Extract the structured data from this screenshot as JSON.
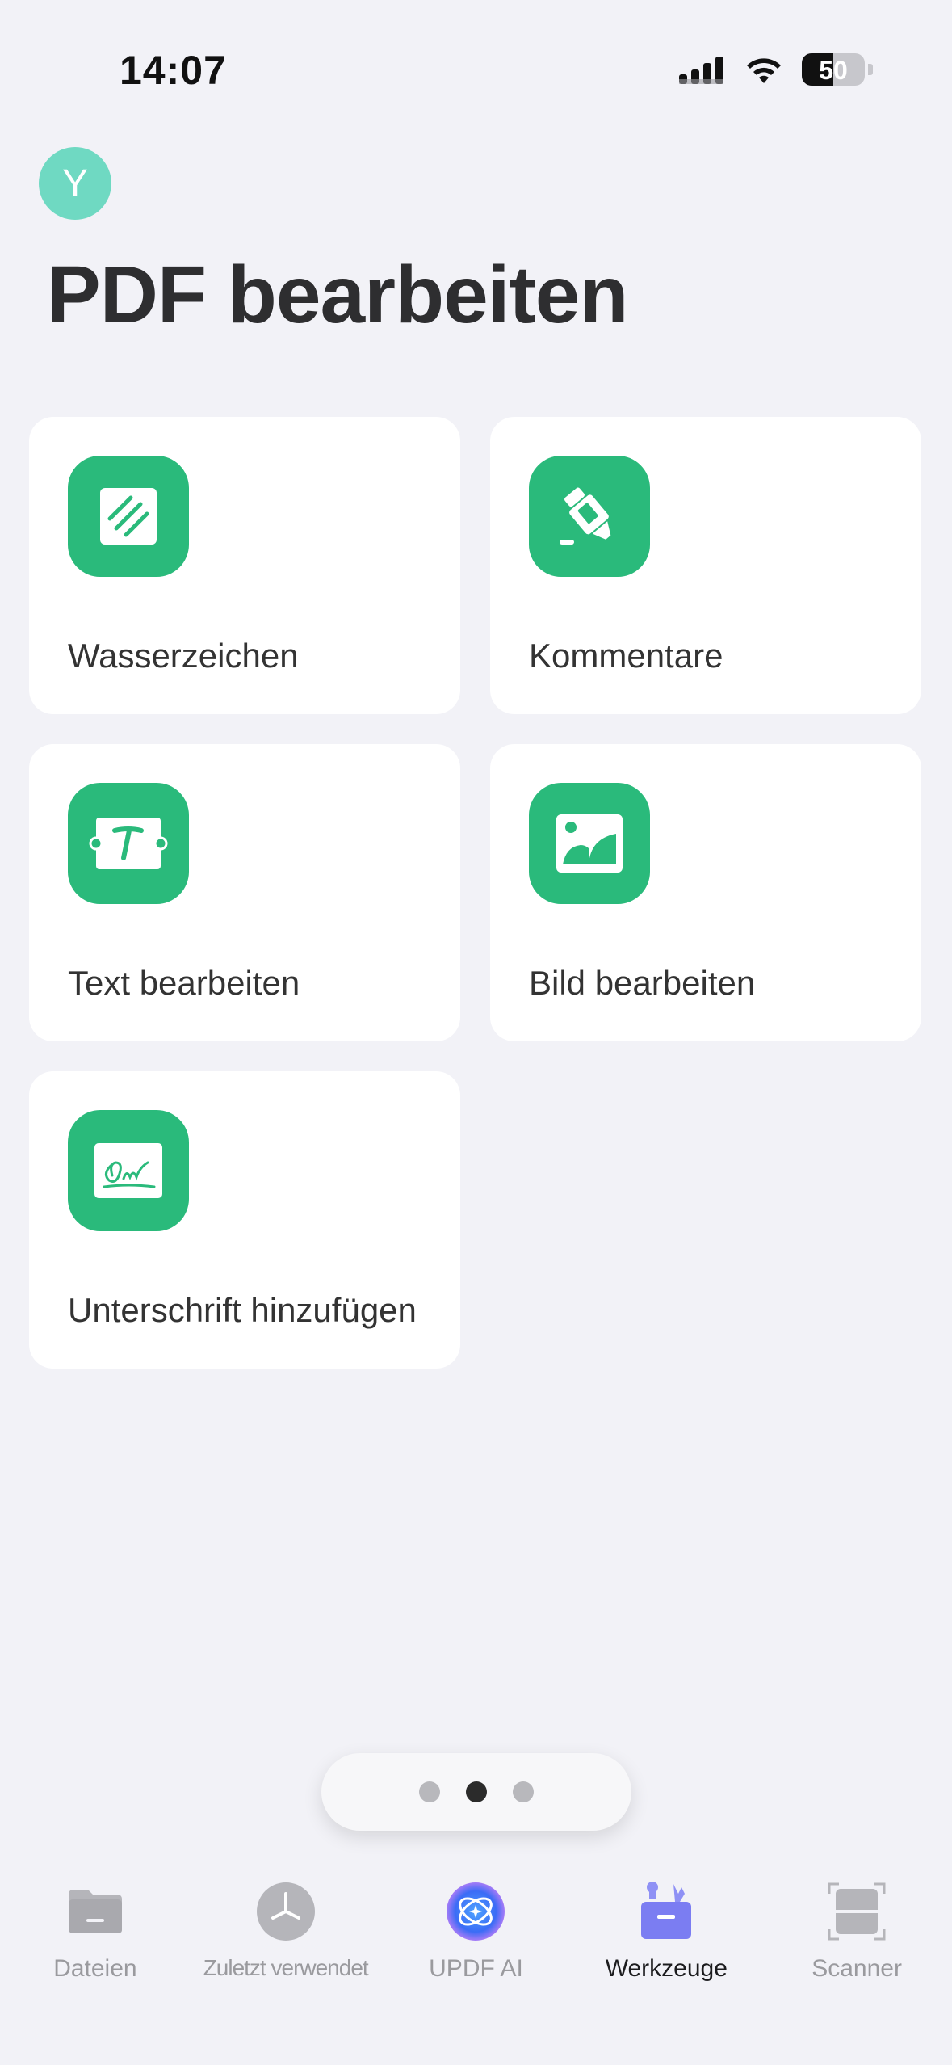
{
  "status_bar": {
    "time": "14:07",
    "battery_level": "50"
  },
  "header": {
    "avatar_initial": "Y",
    "title": "PDF bearbeiten"
  },
  "tools": [
    {
      "label": "Wasserzeichen",
      "icon": "watermark-icon"
    },
    {
      "label": "Kommentare",
      "icon": "highlighter-icon"
    },
    {
      "label": "Text bearbeiten",
      "icon": "text-edit-icon"
    },
    {
      "label": "Bild bearbeiten",
      "icon": "image-edit-icon"
    },
    {
      "label": "Unterschrift hinzufügen",
      "icon": "signature-icon"
    }
  ],
  "pager": {
    "pages": 3,
    "active": 2
  },
  "tab_bar": {
    "tabs": [
      {
        "label": "Dateien",
        "icon": "folder-icon"
      },
      {
        "label": "Zuletzt verwendet",
        "icon": "clock-icon"
      },
      {
        "label": "UPDF AI",
        "icon": "ai-icon"
      },
      {
        "label": "Werkzeuge",
        "icon": "toolbox-icon"
      },
      {
        "label": "Scanner",
        "icon": "scanner-icon"
      }
    ],
    "active": "Werkzeuge"
  },
  "colors": {
    "accent_green": "#2aba7b",
    "background": "#f2f2f7",
    "active_tab_purple": "#7b7df2"
  }
}
